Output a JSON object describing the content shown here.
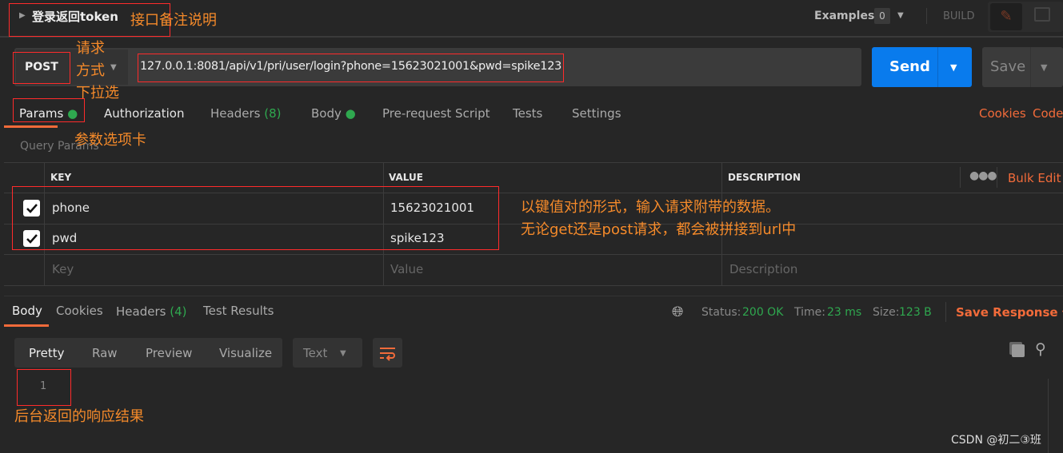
{
  "request": {
    "name": "登录返回token",
    "examples_label": "Examples",
    "examples_count": "0",
    "build_label": "BUILD",
    "method": "POST",
    "url": "127.0.0.1:8081/api/v1/pri/user/login?phone=15623021001&pwd=spike123",
    "send_label": "Send",
    "save_label": "Save"
  },
  "request_tabs": [
    {
      "label": "Params"
    },
    {
      "label": "Authorization"
    },
    {
      "label": "Headers",
      "count": "(8)"
    },
    {
      "label": "Body"
    },
    {
      "label": "Pre-request Script"
    },
    {
      "label": "Tests"
    },
    {
      "label": "Settings"
    }
  ],
  "links": {
    "cookies": "Cookies",
    "code": "Code"
  },
  "params": {
    "title": "Query Params",
    "headers": {
      "key": "KEY",
      "value": "VALUE",
      "description": "DESCRIPTION"
    },
    "bulk_edit": "Bulk Edit",
    "rows": [
      {
        "key": "phone",
        "value": "15623021001",
        "checked": true
      },
      {
        "key": "pwd",
        "value": "spike123",
        "checked": true
      }
    ],
    "placeholders": {
      "key": "Key",
      "value": "Value",
      "description": "Description"
    }
  },
  "response": {
    "tabs": [
      {
        "label": "Body"
      },
      {
        "label": "Cookies"
      },
      {
        "label": "Headers",
        "count": "(4)"
      },
      {
        "label": "Test Results"
      }
    ],
    "status_label": "Status:",
    "status": "200 OK",
    "time_label": "Time:",
    "time": "23 ms",
    "size_label": "Size:",
    "size": "123 B",
    "save_response": "Save Response",
    "views": [
      "Pretty",
      "Raw",
      "Preview",
      "Visualize"
    ],
    "format": "Text",
    "line_number": "1"
  },
  "annotations": {
    "name_note": "接口备注说明",
    "method_note_1": "请求",
    "method_note_2": "方式",
    "method_note_3": "下拉选",
    "params_note": "参数选项卡",
    "kv_note_1": "以键值对的形式，输入请求附带的数据。",
    "kv_note_2": "无论get还是post请求，都会被拼接到url中",
    "response_note": "后台返回的响应结果"
  },
  "watermark": "CSDN @初二③班",
  "colors": {
    "accent": "#f26b3a",
    "send": "#097bed",
    "green": "#2fa84f",
    "annotation": "#f58a2a",
    "annotation_box": "#ff2b2b"
  }
}
